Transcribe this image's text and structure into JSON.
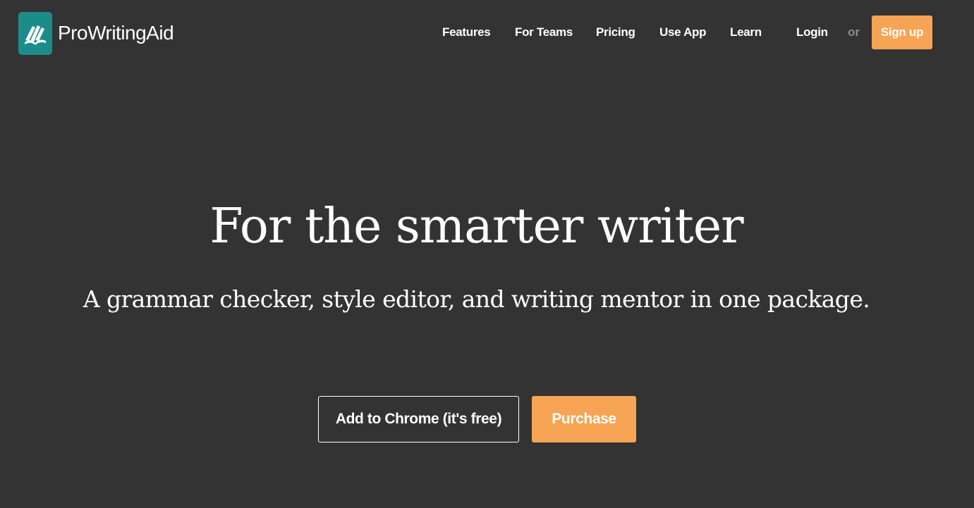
{
  "brand": {
    "name": "ProWritingAid",
    "logo_icon": "prowritingaid-logo-icon",
    "logo_color": "#1c8c8a"
  },
  "nav": {
    "items": [
      {
        "label": "Features"
      },
      {
        "label": "For Teams"
      },
      {
        "label": "Pricing"
      },
      {
        "label": "Use App"
      },
      {
        "label": "Learn"
      },
      {
        "label": "Login"
      }
    ],
    "or_text": "or",
    "signup_label": "Sign up"
  },
  "hero": {
    "title": "For the smarter writer",
    "subtitle": "A grammar checker, style editor, and writing mentor in one package."
  },
  "cta": {
    "chrome_label": "Add to Chrome (it's free)",
    "purchase_label": "Purchase"
  },
  "colors": {
    "background": "#333333",
    "accent": "#f7a454",
    "text": "#ffffff",
    "muted": "#8c8c8c"
  }
}
